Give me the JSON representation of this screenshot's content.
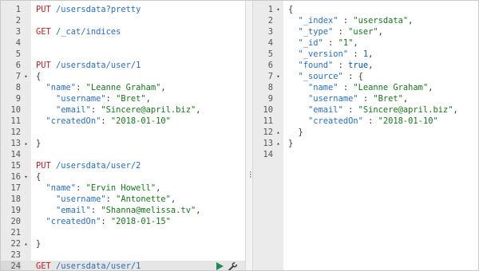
{
  "console": {
    "request_lines": [
      {
        "n": "1",
        "tokens": [
          {
            "t": "PUT",
            "c": "m"
          },
          {
            "t": " /usersdata?pretty",
            "c": "u"
          }
        ]
      },
      {
        "n": "2",
        "tokens": []
      },
      {
        "n": "3",
        "tokens": [
          {
            "t": "GET",
            "c": "m"
          },
          {
            "t": " /_cat/indices",
            "c": "u"
          }
        ]
      },
      {
        "n": "4",
        "tokens": []
      },
      {
        "n": "5",
        "tokens": []
      },
      {
        "n": "6",
        "tokens": [
          {
            "t": "PUT",
            "c": "m"
          },
          {
            "t": " /usersdata/user/1",
            "c": "u"
          }
        ]
      },
      {
        "n": "7",
        "fold": "▾",
        "tokens": [
          {
            "t": "{",
            "c": "p"
          }
        ]
      },
      {
        "n": "8",
        "tokens": [
          {
            "t": "  ",
            "c": "p"
          },
          {
            "t": "\"name\"",
            "c": "k"
          },
          {
            "t": ": ",
            "c": "p"
          },
          {
            "t": "\"Leanne Graham\"",
            "c": "s"
          },
          {
            "t": ",",
            "c": "p"
          }
        ]
      },
      {
        "n": "9",
        "tokens": [
          {
            "t": "    ",
            "c": "p"
          },
          {
            "t": "\"username\"",
            "c": "k"
          },
          {
            "t": ": ",
            "c": "p"
          },
          {
            "t": "\"Bret\"",
            "c": "s"
          },
          {
            "t": ",",
            "c": "p"
          }
        ]
      },
      {
        "n": "10",
        "tokens": [
          {
            "t": "    ",
            "c": "p"
          },
          {
            "t": "\"email\"",
            "c": "k"
          },
          {
            "t": ": ",
            "c": "p"
          },
          {
            "t": "\"Sincere@april.biz\"",
            "c": "s"
          },
          {
            "t": ",",
            "c": "p"
          }
        ]
      },
      {
        "n": "11",
        "tokens": [
          {
            "t": "  ",
            "c": "p"
          },
          {
            "t": "\"createdOn\"",
            "c": "k"
          },
          {
            "t": ": ",
            "c": "p"
          },
          {
            "t": "\"2018-01-10\"",
            "c": "s"
          }
        ]
      },
      {
        "n": "12",
        "tokens": []
      },
      {
        "n": "13",
        "fold": "▴",
        "tokens": [
          {
            "t": "}",
            "c": "p"
          }
        ]
      },
      {
        "n": "14",
        "tokens": []
      },
      {
        "n": "15",
        "tokens": [
          {
            "t": "PUT",
            "c": "m"
          },
          {
            "t": " /usersdata/user/2",
            "c": "u"
          }
        ]
      },
      {
        "n": "16",
        "fold": "▾",
        "tokens": [
          {
            "t": "{",
            "c": "p"
          }
        ]
      },
      {
        "n": "17",
        "tokens": [
          {
            "t": "  ",
            "c": "p"
          },
          {
            "t": "\"name\"",
            "c": "k"
          },
          {
            "t": ": ",
            "c": "p"
          },
          {
            "t": "\"Ervin Howell\"",
            "c": "s"
          },
          {
            "t": ",",
            "c": "p"
          }
        ]
      },
      {
        "n": "18",
        "tokens": [
          {
            "t": "    ",
            "c": "p"
          },
          {
            "t": "\"username\"",
            "c": "k"
          },
          {
            "t": ": ",
            "c": "p"
          },
          {
            "t": "\"Antonette\"",
            "c": "s"
          },
          {
            "t": ",",
            "c": "p"
          }
        ]
      },
      {
        "n": "19",
        "tokens": [
          {
            "t": "    ",
            "c": "p"
          },
          {
            "t": "\"email\"",
            "c": "k"
          },
          {
            "t": ": ",
            "c": "p"
          },
          {
            "t": "\"Shanna@melissa.tv\"",
            "c": "s"
          },
          {
            "t": ",",
            "c": "p"
          }
        ]
      },
      {
        "n": "20",
        "tokens": [
          {
            "t": "  ",
            "c": "p"
          },
          {
            "t": "\"createdOn\"",
            "c": "k"
          },
          {
            "t": ": ",
            "c": "p"
          },
          {
            "t": "\"2018-01-15\"",
            "c": "s"
          }
        ]
      },
      {
        "n": "21",
        "tokens": []
      },
      {
        "n": "22",
        "fold": "▴",
        "tokens": [
          {
            "t": "}",
            "c": "p"
          }
        ]
      },
      {
        "n": "23",
        "tokens": []
      },
      {
        "n": "24",
        "active": true,
        "tokens": [
          {
            "t": "GET",
            "c": "m"
          },
          {
            "t": " /usersdata/user/1",
            "c": "u"
          }
        ]
      }
    ],
    "response_lines": [
      {
        "n": "1",
        "fold": "▾",
        "tokens": [
          {
            "t": "{",
            "c": "p"
          }
        ]
      },
      {
        "n": "2",
        "tokens": [
          {
            "t": "  ",
            "c": "p"
          },
          {
            "t": "\"_index\"",
            "c": "k"
          },
          {
            "t": " : ",
            "c": "p"
          },
          {
            "t": "\"usersdata\"",
            "c": "s"
          },
          {
            "t": ",",
            "c": "p"
          }
        ]
      },
      {
        "n": "3",
        "tokens": [
          {
            "t": "  ",
            "c": "p"
          },
          {
            "t": "\"_type\"",
            "c": "k"
          },
          {
            "t": " : ",
            "c": "p"
          },
          {
            "t": "\"user\"",
            "c": "s"
          },
          {
            "t": ",",
            "c": "p"
          }
        ]
      },
      {
        "n": "4",
        "tokens": [
          {
            "t": "  ",
            "c": "p"
          },
          {
            "t": "\"_id\"",
            "c": "k"
          },
          {
            "t": " : ",
            "c": "p"
          },
          {
            "t": "\"1\"",
            "c": "s"
          },
          {
            "t": ",",
            "c": "p"
          }
        ]
      },
      {
        "n": "5",
        "tokens": [
          {
            "t": "  ",
            "c": "p"
          },
          {
            "t": "\"_version\"",
            "c": "k"
          },
          {
            "t": " : ",
            "c": "p"
          },
          {
            "t": "1",
            "c": "n"
          },
          {
            "t": ",",
            "c": "p"
          }
        ]
      },
      {
        "n": "6",
        "tokens": [
          {
            "t": "  ",
            "c": "p"
          },
          {
            "t": "\"found\"",
            "c": "k"
          },
          {
            "t": " : ",
            "c": "p"
          },
          {
            "t": "true",
            "c": "b"
          },
          {
            "t": ",",
            "c": "p"
          }
        ]
      },
      {
        "n": "7",
        "fold": "▾",
        "tokens": [
          {
            "t": "  ",
            "c": "p"
          },
          {
            "t": "\"_source\"",
            "c": "k"
          },
          {
            "t": " : {",
            "c": "p"
          }
        ]
      },
      {
        "n": "8",
        "tokens": [
          {
            "t": "    ",
            "c": "p"
          },
          {
            "t": "\"name\"",
            "c": "k"
          },
          {
            "t": " : ",
            "c": "p"
          },
          {
            "t": "\"Leanne Graham\"",
            "c": "s"
          },
          {
            "t": ",",
            "c": "p"
          }
        ]
      },
      {
        "n": "9",
        "tokens": [
          {
            "t": "    ",
            "c": "p"
          },
          {
            "t": "\"username\"",
            "c": "k"
          },
          {
            "t": " : ",
            "c": "p"
          },
          {
            "t": "\"Bret\"",
            "c": "s"
          },
          {
            "t": ",",
            "c": "p"
          }
        ]
      },
      {
        "n": "10",
        "tokens": [
          {
            "t": "    ",
            "c": "p"
          },
          {
            "t": "\"email\"",
            "c": "k"
          },
          {
            "t": " : ",
            "c": "p"
          },
          {
            "t": "\"Sincere@april.biz\"",
            "c": "s"
          },
          {
            "t": ",",
            "c": "p"
          }
        ]
      },
      {
        "n": "11",
        "tokens": [
          {
            "t": "    ",
            "c": "p"
          },
          {
            "t": "\"createdOn\"",
            "c": "k"
          },
          {
            "t": " : ",
            "c": "p"
          },
          {
            "t": "\"2018-01-10\"",
            "c": "s"
          }
        ]
      },
      {
        "n": "12",
        "fold": "▴",
        "tokens": [
          {
            "t": "  }",
            "c": "p"
          }
        ]
      },
      {
        "n": "13",
        "fold": "▴",
        "tokens": [
          {
            "t": "}",
            "c": "p"
          }
        ]
      },
      {
        "n": "14",
        "tokens": []
      }
    ],
    "actions": {
      "play_icon": "play-icon",
      "wrench_icon": "wrench-icon",
      "play_color": "#1e8b57",
      "wrench_color": "#444444"
    },
    "divider_icon": "vertical-dots-icon"
  }
}
